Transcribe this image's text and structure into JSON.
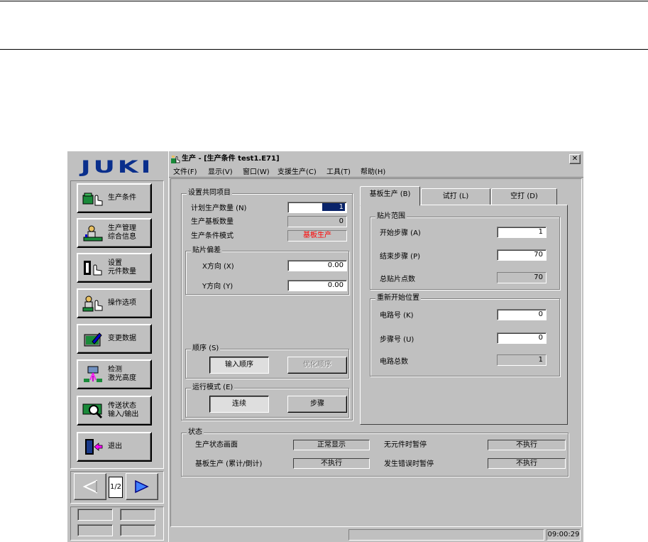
{
  "brand": {
    "logo": "JUKI"
  },
  "window": {
    "title": "生产 - [生产条件 test1.E71]",
    "close_label": "✕"
  },
  "menu": {
    "items": [
      "文件(F)",
      "显示(V)",
      "窗口(W)",
      "支援生产(C)",
      "工具(T)",
      "帮助(H)"
    ]
  },
  "sidebar": {
    "buttons": [
      {
        "label": "生产条件"
      },
      {
        "label": "生产管理\n综合信息"
      },
      {
        "label": "设置\n元件数量"
      },
      {
        "label": "操作选项"
      },
      {
        "label": "变更数据"
      },
      {
        "label": "检测\n激光高度"
      },
      {
        "label": "传送状态\n输入/输出"
      },
      {
        "label": "退出"
      }
    ],
    "page_indicator": "1/2"
  },
  "common": {
    "title": "设置共同项目",
    "plan_qty_label": "计划生产数量 (N)",
    "plan_qty_value": "1",
    "board_qty_label": "生产基板数量",
    "board_qty_value": "0",
    "mode_label": "生产条件模式",
    "mode_value": "基板生产",
    "offset_title": "贴片偏差",
    "x_label": "X方向 (X)",
    "x_value": "0.00",
    "y_label": "Y方向 (Y)",
    "y_value": "0.00"
  },
  "order": {
    "title": "顺序 (S)",
    "input_label": "输入顺序",
    "optimize_label": "优化顺序"
  },
  "run_mode": {
    "title": "运行模式 (E)",
    "continuous_label": "连续",
    "step_label": "步骤"
  },
  "tabs": [
    "基板生产 (B)",
    "试打 (L)",
    "空打 (D)"
  ],
  "range": {
    "title": "贴片范围",
    "start_label": "开始步骤 (A)",
    "start_value": "1",
    "end_label": "结束步骤 (P)",
    "end_value": "70",
    "total_label": "总贴片点数",
    "total_value": "70"
  },
  "restart": {
    "title": "重新开始位置",
    "circuit_label": "电路号 (K)",
    "circuit_value": "0",
    "step_label": "步骤号 (U)",
    "step_value": "0",
    "circuit_total_label": "电路总数",
    "circuit_total_value": "1"
  },
  "status": {
    "title": "状态",
    "screen_label": "生产状态画面",
    "screen_value": "正常显示",
    "no_part_label": "无元件时暂停",
    "no_part_value": "不执行",
    "board_count_label": "基板生产 (累计/倒计)",
    "board_count_value": "不执行",
    "error_label": "发生错误时暂停",
    "error_value": "不执行"
  },
  "statusbar": {
    "time": "09:00:29"
  },
  "colors": {
    "title_bar": "#000080",
    "mode_value": "#ff0000",
    "brand_blue": "#0a2f8c"
  }
}
